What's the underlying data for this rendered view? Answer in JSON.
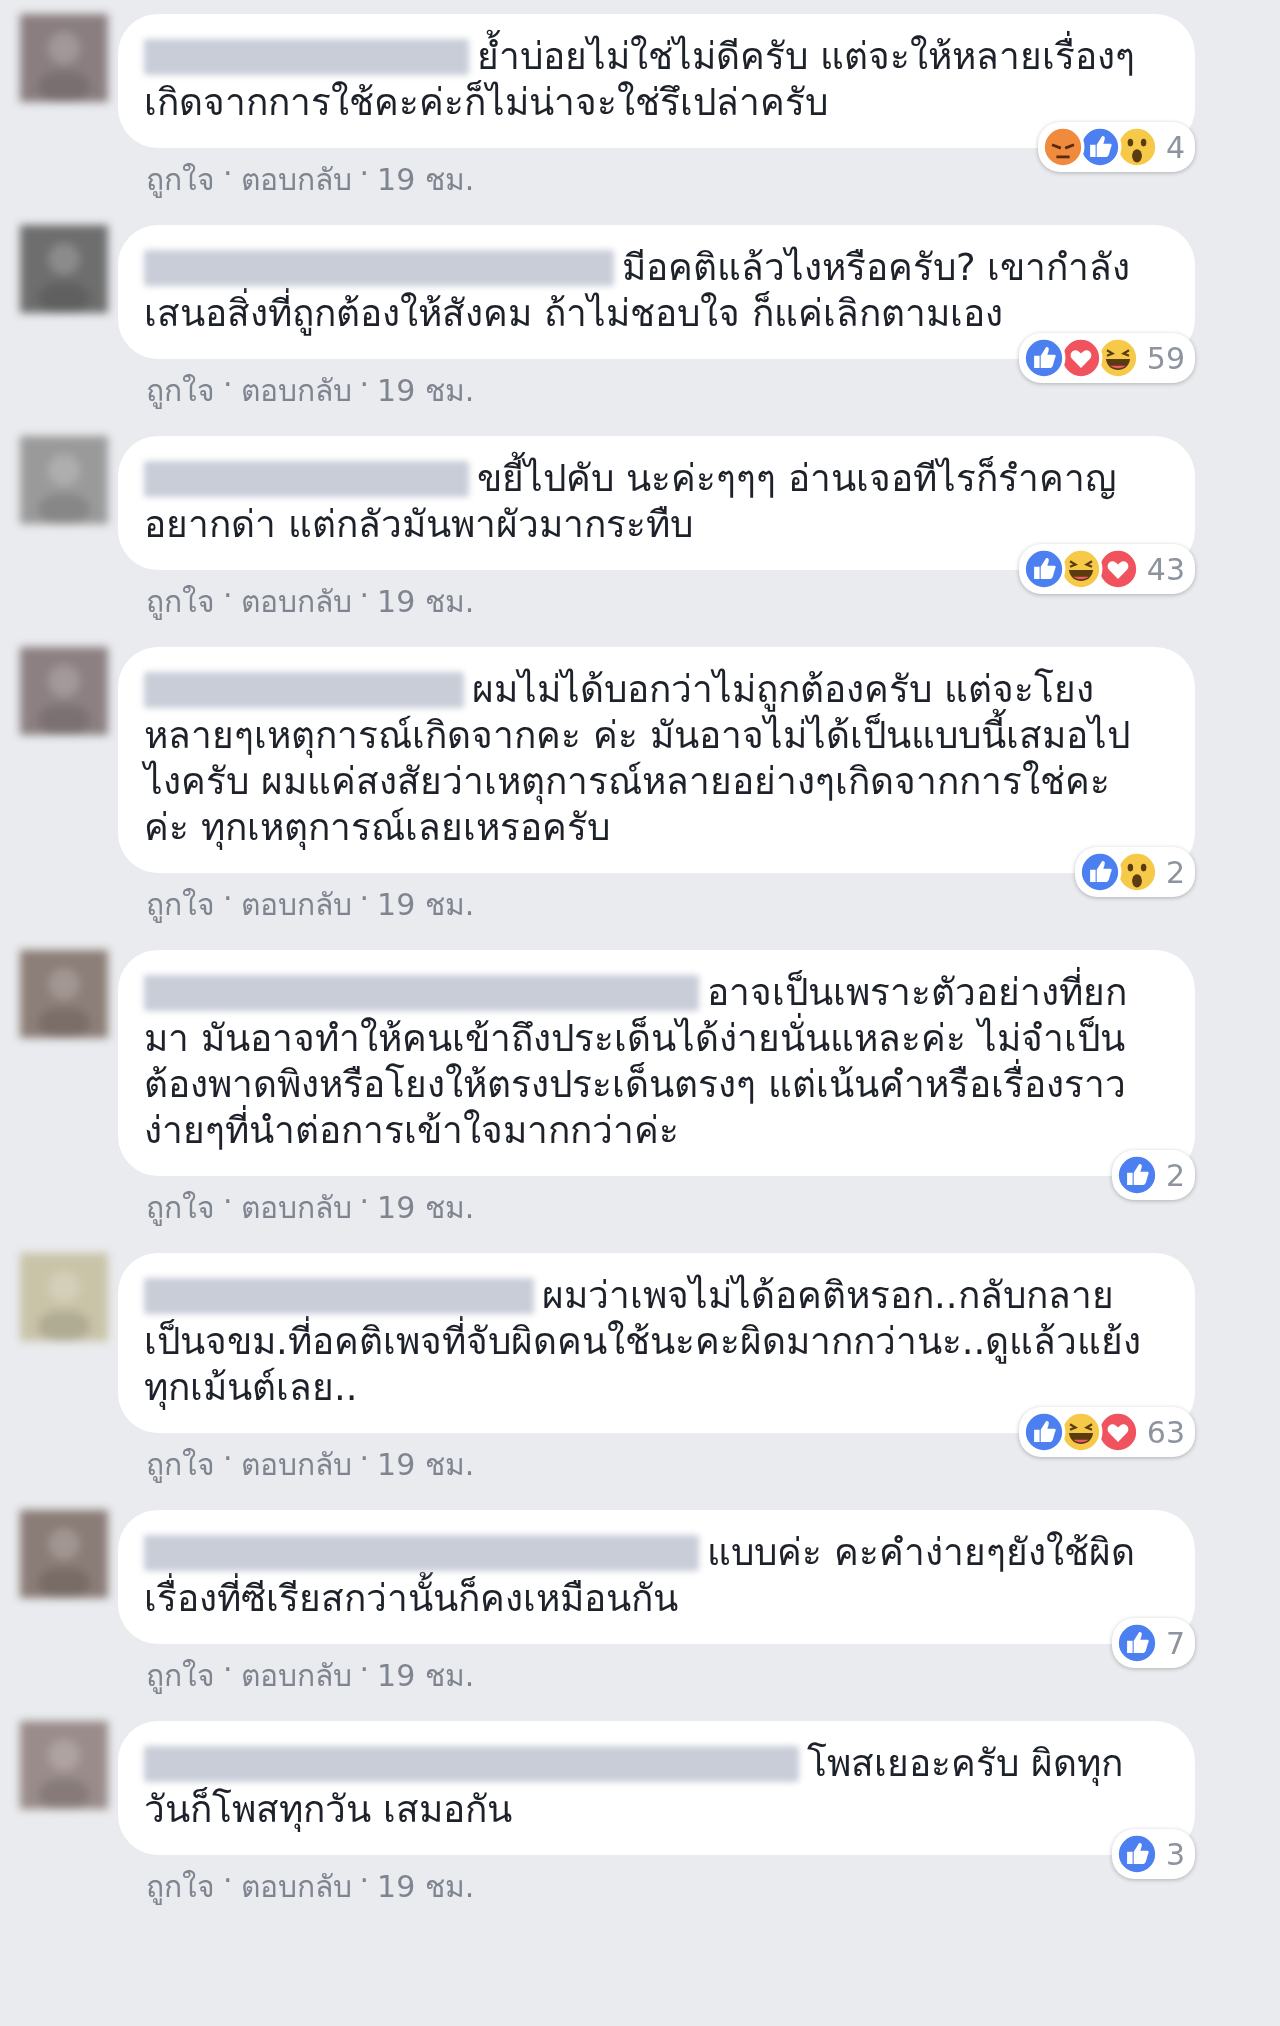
{
  "comments": [
    {
      "text": "ย้ำบ่อยไม่ใช่ไม่ดีครับ แต่จะให้หลายเรื่องๆเกิดจากการใช้คะค่ะก็ไม่น่าจะใช่รึเปล่าครับ",
      "reactions": [
        {
          "kind": "angry"
        },
        {
          "kind": "like"
        },
        {
          "kind": "wow"
        }
      ],
      "reaction_count": "4",
      "like_label": "ถูกใจ",
      "reply_label": "ตอบกลับ",
      "separator": "·",
      "time": "19 ชม."
    },
    {
      "text": "มีอคติแล้วไงหรือครับ? เขากำลังเสนอสิ่งที่ถูกต้องให้สังคม ถ้าไม่ชอบใจ ก็แค่เลิกตามเอง",
      "reactions": [
        {
          "kind": "like"
        },
        {
          "kind": "love"
        },
        {
          "kind": "haha"
        }
      ],
      "reaction_count": "59",
      "like_label": "ถูกใจ",
      "reply_label": "ตอบกลับ",
      "separator": "·",
      "time": "19 ชม."
    },
    {
      "text": "ขยี้ไปคับ นะค่ะๆๆๆ อ่านเจอทีไรก็รำคาญอยากด่า แต่กลัวมันพาผัวมากระทืบ",
      "reactions": [
        {
          "kind": "like"
        },
        {
          "kind": "haha"
        },
        {
          "kind": "love"
        }
      ],
      "reaction_count": "43",
      "like_label": "ถูกใจ",
      "reply_label": "ตอบกลับ",
      "separator": "·",
      "time": "19 ชม."
    },
    {
      "text": "ผมไม่ได้บอกว่าไม่ถูกต้องครับ แต่จะโยงหลายๆเหตุการณ์เกิดจากคะ ค่ะ มันอาจไม่ได้เป็นแบบนี้เสมอไปไงครับ ผมแค่สงสัยว่าเหตุการณ์หลายอย่างๆเกิดจากการใช่คะ ค่ะ ทุกเหตุการณ์เลยเหรอครับ",
      "reactions": [
        {
          "kind": "like"
        },
        {
          "kind": "wow"
        }
      ],
      "reaction_count": "2",
      "like_label": "ถูกใจ",
      "reply_label": "ตอบกลับ",
      "separator": "·",
      "time": "19 ชม."
    },
    {
      "text": "อาจเป็นเพราะตัวอย่างที่ยกมา มันอาจทำให้คนเข้าถึงประเด็นได้ง่ายนั่นแหละค่ะ ไม่จำเป็นต้องพาดพิงหรือโยงให้ตรงประเด็นตรงๆ แต่เน้นคำหรือเรื่องราวง่ายๆที่นำต่อการเข้าใจมากกว่าค่ะ",
      "reactions": [
        {
          "kind": "like"
        }
      ],
      "reaction_count": "2",
      "like_label": "ถูกใจ",
      "reply_label": "ตอบกลับ",
      "separator": "·",
      "time": "19 ชม."
    },
    {
      "text": "ผมว่าเพจไม่ได้อคติหรอก..กลับกลายเป็นจขม.ที่อคติเพจที่จับผิดคนใช้นะคะผิดมากกว่านะ..ดูแล้วแย้งทุกเม้นต์เลย..",
      "reactions": [
        {
          "kind": "like"
        },
        {
          "kind": "haha"
        },
        {
          "kind": "love"
        }
      ],
      "reaction_count": "63",
      "like_label": "ถูกใจ",
      "reply_label": "ตอบกลับ",
      "separator": "·",
      "time": "19 ชม."
    },
    {
      "text": "แบบค่ะ คะคำง่ายๆยังใช้ผิด เรื่องที่ซีเรียสกว่านั้นก็คงเหมือนกัน",
      "reactions": [
        {
          "kind": "like"
        }
      ],
      "reaction_count": "7",
      "like_label": "ถูกใจ",
      "reply_label": "ตอบกลับ",
      "separator": "·",
      "time": "19 ชม."
    },
    {
      "text": "โพสเยอะครับ ผิดทุกวันก็โพสทุกวัน เสมอกัน",
      "reactions": [
        {
          "kind": "like"
        }
      ],
      "reaction_count": "3",
      "like_label": "ถูกใจ",
      "reply_label": "ตอบกลับ",
      "separator": "·",
      "time": "19 ชม."
    }
  ]
}
